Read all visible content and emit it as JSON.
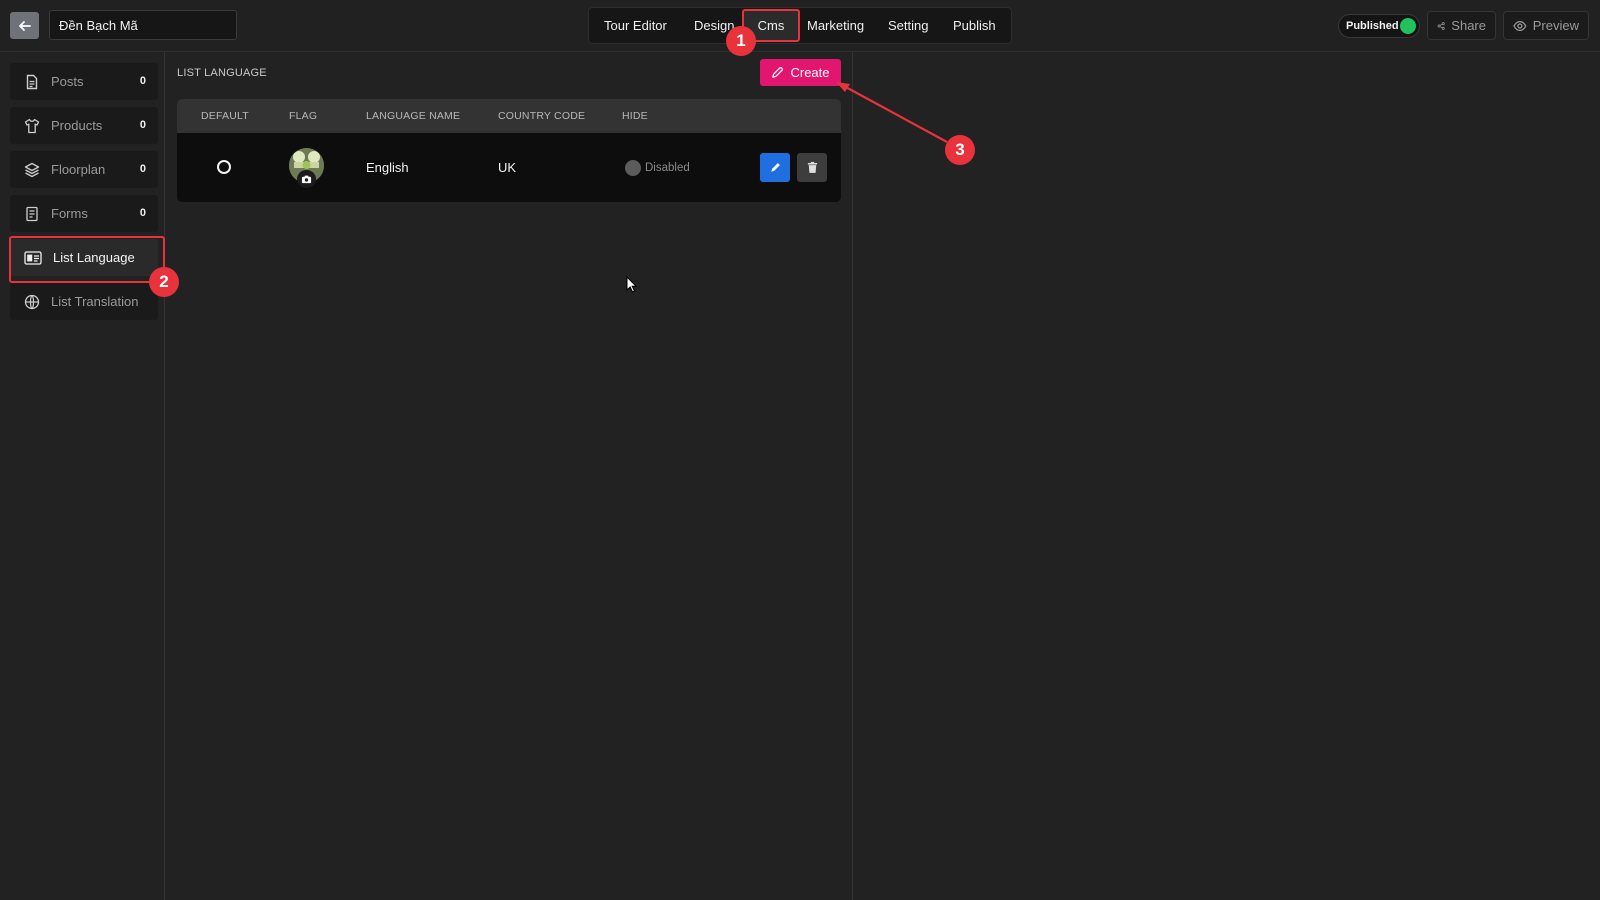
{
  "header": {
    "tour_name": "Đền Bạch Mã",
    "nav": [
      "Tour Editor",
      "Design",
      "Cms",
      "Marketing",
      "Setting",
      "Publish"
    ],
    "published_label": "Published",
    "published_status_color": "#21c25e",
    "share_label": "Share",
    "preview_label": "Preview"
  },
  "sidebar": {
    "items": [
      {
        "label": "Posts",
        "count": "0",
        "icon": "document-icon"
      },
      {
        "label": "Products",
        "count": "0",
        "icon": "shirt-icon"
      },
      {
        "label": "Floorplan",
        "count": "0",
        "icon": "layers-icon"
      },
      {
        "label": "Forms",
        "count": "0",
        "icon": "form-icon"
      },
      {
        "label": "List Language",
        "count": "",
        "icon": "language-card-icon"
      },
      {
        "label": "List Translation",
        "count": "",
        "icon": "globe-icon"
      }
    ]
  },
  "main": {
    "section_title": "LIST LANGUAGE",
    "create_label": "Create",
    "table": {
      "headers": [
        "DEFAULT",
        "FLAG",
        "LANGUAGE NAME",
        "COUNTRY CODE",
        "HIDE"
      ],
      "rows": [
        {
          "language_name": "English",
          "country_code": "UK",
          "hide_status": "Disabled"
        }
      ]
    }
  },
  "annotations": {
    "badges": [
      "1",
      "2",
      "3"
    ],
    "color": "#e8333c"
  },
  "colors": {
    "accent_pink": "#e2156f",
    "edit_blue": "#1f6fe0"
  }
}
